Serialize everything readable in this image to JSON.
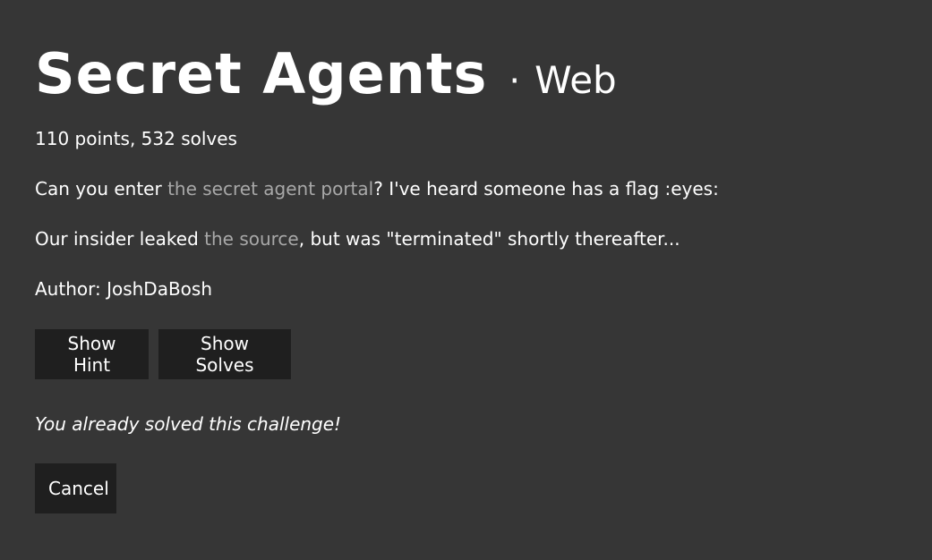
{
  "challenge": {
    "title": "Secret Agents",
    "separator": "·",
    "category": "Web",
    "stats": "110 points, 532 solves",
    "description_line1": {
      "before": "Can you enter ",
      "link": "the secret agent portal",
      "after": "? I've heard someone has a flag :eyes:"
    },
    "description_line2": {
      "before": "Our insider leaked ",
      "link": "the source",
      "after": ", but was \"terminated\" shortly thereafter..."
    },
    "author": "Author: JoshDaBosh"
  },
  "buttons": {
    "show_hint": "Show Hint",
    "show_solves": "Show Solves",
    "cancel": "Cancel"
  },
  "status": {
    "solved_message": "You already solved this challenge!"
  },
  "colors": {
    "background": "#363636",
    "button_bg": "#1f1f1f",
    "link": "#a8a8a8",
    "text": "#ffffff"
  }
}
